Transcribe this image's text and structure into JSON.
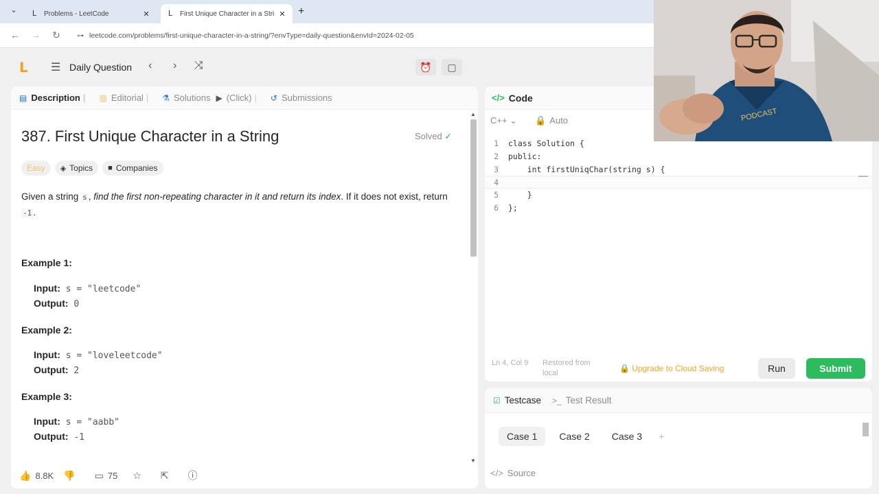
{
  "browser": {
    "tabs": [
      {
        "title": "Problems - LeetCode",
        "active": false
      },
      {
        "title": "First Unique Character in a Stri",
        "active": true
      }
    ],
    "url": "leetcode.com/problems/first-unique-character-in-a-string/?envType=daily-question&envId=2024-02-05"
  },
  "header": {
    "daily_label": "Daily Question"
  },
  "left": {
    "tabs": [
      {
        "label": "Description",
        "icon": "document-icon"
      },
      {
        "label": "Editorial",
        "icon": "book-icon"
      },
      {
        "label": "Solutions",
        "icon": "flask-icon"
      },
      {
        "label": "(Click)",
        "icon": "play-icon"
      },
      {
        "label": "Submissions",
        "icon": "history-icon"
      }
    ],
    "title": "387. First Unique Character in a String",
    "solved": "Solved",
    "badges": {
      "difficulty": "Easy",
      "topics": "Topics",
      "companies": "Companies"
    },
    "description": {
      "pre": "Given a string",
      "var": "s",
      "em": "find the first non-repeating character in it and return its index",
      "post": ". If it does not exist, return",
      "neg": "-1",
      "end": "."
    },
    "examples": [
      {
        "title": "Example 1:",
        "input_label": "Input:",
        "input": "s = \"leetcode\"",
        "output_label": "Output:",
        "output": "0"
      },
      {
        "title": "Example 2:",
        "input_label": "Input:",
        "input": "s = \"loveleetcode\"",
        "output_label": "Output:",
        "output": "2"
      },
      {
        "title": "Example 3:",
        "input_label": "Input:",
        "input": "s = \"aabb\"",
        "output_label": "Output:",
        "output": "-1"
      }
    ],
    "footer": {
      "likes": "8.8K",
      "comments": "75"
    }
  },
  "code": {
    "header": "Code",
    "language": "C++",
    "mode": "Auto",
    "lines": [
      "class Solution {",
      "public:",
      "    int firstUniqChar(string s) {",
      "        ",
      "    }",
      "};"
    ],
    "status": {
      "position": "Ln 4, Col 9",
      "restored": "Restored from local",
      "upgrade": "Upgrade to Cloud Saving"
    },
    "run_label": "Run",
    "submit_label": "Submit"
  },
  "test": {
    "tabs": [
      {
        "label": "Testcase"
      },
      {
        "label": "Test Result"
      }
    ],
    "cases": [
      "Case 1",
      "Case 2",
      "Case 3"
    ],
    "source_label": "Source"
  },
  "colors": {
    "accent": "#2cbb5d",
    "easy": "#f5c26b",
    "brand": "#f89f1b"
  }
}
